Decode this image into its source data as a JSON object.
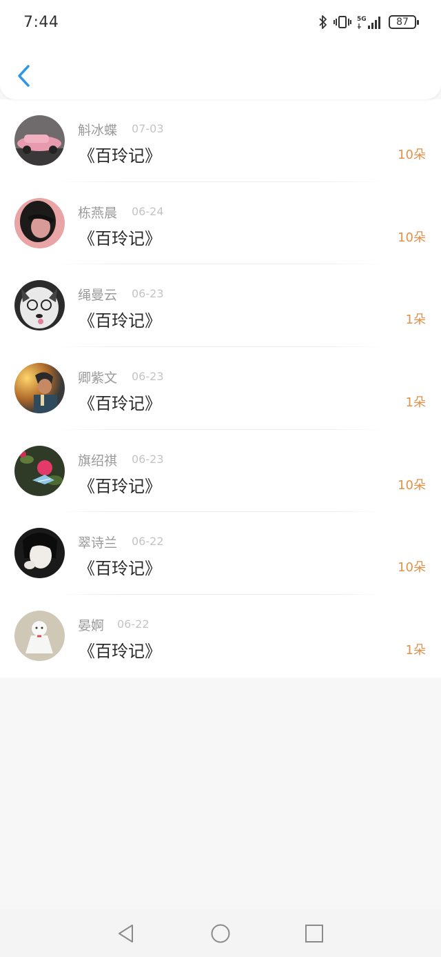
{
  "status_bar": {
    "time": "7:44",
    "network": "5G",
    "battery": "87"
  },
  "header": {
    "back_icon": "chevron-left-icon",
    "accent_color": "#2f96e6"
  },
  "records": [
    {
      "name": "斛冰蝶",
      "date": "07-03",
      "book": "《百玲记》",
      "amount": "10朵",
      "avatar": "pink-car"
    },
    {
      "name": "栋燕晨",
      "date": "06-24",
      "book": "《百玲记》",
      "amount": "10朵",
      "avatar": "girl-red-background"
    },
    {
      "name": "绳曼云",
      "date": "06-23",
      "book": "《百玲记》",
      "amount": "1朵",
      "avatar": "husky-with-glasses"
    },
    {
      "name": "卿紫文",
      "date": "06-23",
      "book": "《百玲记》",
      "amount": "1朵",
      "avatar": "person-sunset"
    },
    {
      "name": "旗绍祺",
      "date": "06-23",
      "book": "《百玲记》",
      "amount": "10朵",
      "avatar": "pink-flower-butterfly"
    },
    {
      "name": "翠诗兰",
      "date": "06-22",
      "book": "《百玲记》",
      "amount": "10朵",
      "avatar": "black-hair-girl"
    },
    {
      "name": "晏婀",
      "date": "06-22",
      "book": "《百玲记》",
      "amount": "1朵",
      "avatar": "white-doll"
    }
  ],
  "colors": {
    "amount": "#e0914a",
    "name": "#9a9a9a",
    "date": "#c4c4c4"
  },
  "nav_bar": {
    "icons": [
      "back-triangle-icon",
      "home-circle-icon",
      "recents-square-icon"
    ]
  }
}
